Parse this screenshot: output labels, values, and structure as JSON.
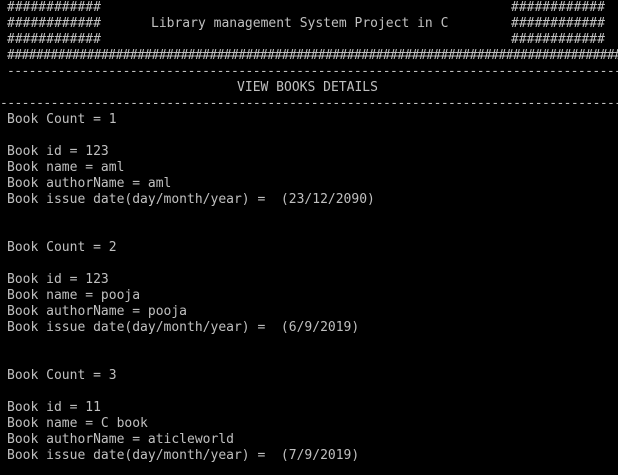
{
  "header": {
    "hash_short": "############",
    "hash_full": "##################################################################################################",
    "title": "Library management System Project in C"
  },
  "rules": {
    "dashes": "------------------------------------------------------------------------------------------------------------------------"
  },
  "section": {
    "title": "VIEW BOOKS DETAILS"
  },
  "records": [
    {
      "count": "Book Count = 1",
      "id": "Book id = 123",
      "name": "Book name = aml",
      "author": "Book authorName = aml",
      "issue_date": "Book issue date(day/month/year) =  (23/12/2090)"
    },
    {
      "count": "Book Count = 2",
      "id": "Book id = 123",
      "name": "Book name = pooja",
      "author": "Book authorName = pooja",
      "issue_date": "Book issue date(day/month/year) =  (6/9/2019)"
    },
    {
      "count": "Book Count = 3",
      "id": "Book id = 11",
      "name": "Book name = C book",
      "author": "Book authorName = aticleworld",
      "issue_date": "Book issue date(day/month/year) =  (7/9/2019)"
    }
  ]
}
